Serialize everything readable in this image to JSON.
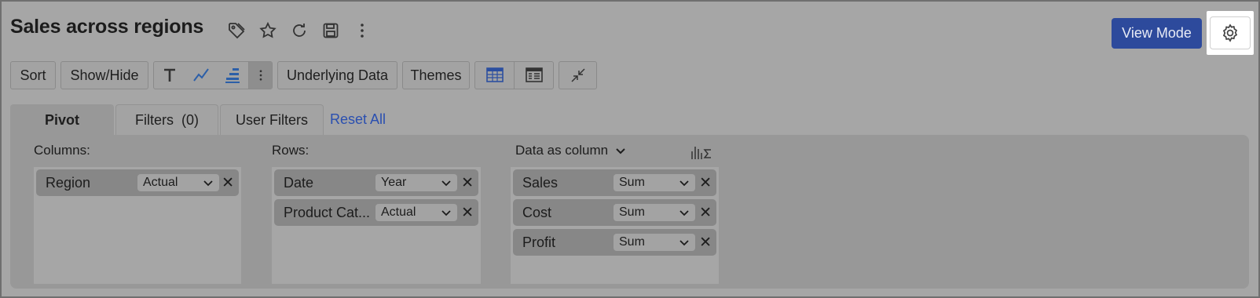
{
  "report": {
    "title": "Sales across regions",
    "title_icons": [
      "tag-icon",
      "star-icon",
      "refresh-icon",
      "save-icon",
      "more-vertical-icon"
    ]
  },
  "header": {
    "view_mode_label": "View Mode",
    "settings_icon": "gear-icon"
  },
  "toolbar": {
    "sort_label": "Sort",
    "show_hide_label": "Show/Hide",
    "format_icons": [
      "text-format-icon",
      "sparkline-icon",
      "bar-format-icon",
      "more-vertical-icon"
    ],
    "underlying_data_label": "Underlying Data",
    "themes_label": "Themes",
    "layout_icons": [
      "tabular-layout-icon",
      "compact-layout-icon"
    ],
    "collapse_icon": "collapse-arrows-icon"
  },
  "tabs": [
    {
      "label": "Pivot",
      "active": true
    },
    {
      "label": "Filters  (0)",
      "active": false
    },
    {
      "label": "User Filters",
      "active": false
    }
  ],
  "reset_all_label": "Reset All",
  "shelves": {
    "columns": {
      "label": "Columns:",
      "fields": [
        {
          "name": "Region",
          "aggregation": "Actual"
        }
      ]
    },
    "rows": {
      "label": "Rows:",
      "fields": [
        {
          "name": "Date",
          "aggregation": "Year"
        },
        {
          "name": "Product Cat...",
          "aggregation": "Actual"
        }
      ]
    },
    "data": {
      "label": "Data as column",
      "fields": [
        {
          "name": "Sales",
          "aggregation": "Sum"
        },
        {
          "name": "Cost",
          "aggregation": "Sum"
        },
        {
          "name": "Profit",
          "aggregation": "Sum"
        }
      ]
    }
  },
  "remove_glyph": "✕",
  "colors": {
    "overlay": "#a6a6a6",
    "primary_button": "#2d4a9c",
    "link": "#2a4fb0"
  }
}
